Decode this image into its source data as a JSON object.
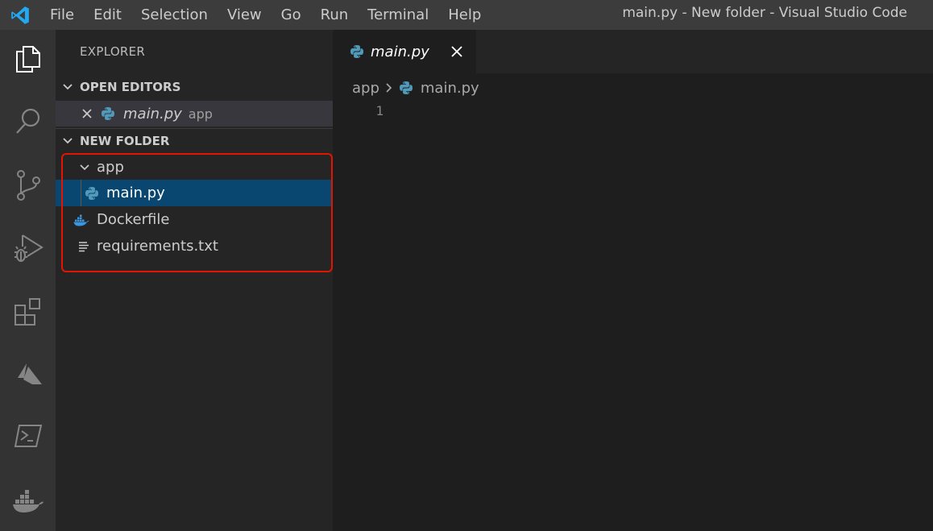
{
  "menu": [
    "File",
    "Edit",
    "Selection",
    "View",
    "Go",
    "Run",
    "Terminal",
    "Help"
  ],
  "window_title": "main.py - New folder - Visual Studio Code",
  "activity_bar": [
    "files-icon",
    "search-icon",
    "source-control-icon",
    "run-debug-icon",
    "extensions-icon",
    "azure-icon",
    "powershell-icon",
    "docker-icon"
  ],
  "sidebar": {
    "title": "EXPLORER",
    "open_editors": {
      "header": "OPEN EDITORS",
      "items": [
        {
          "name": "main.py",
          "folder": "app"
        }
      ]
    },
    "folder": {
      "header": "NEW FOLDER",
      "items": [
        {
          "name": "app",
          "type": "folder"
        },
        {
          "name": "main.py",
          "type": "python"
        },
        {
          "name": "Dockerfile",
          "type": "docker"
        },
        {
          "name": "requirements.txt",
          "type": "text"
        }
      ]
    }
  },
  "editor": {
    "tab_label": "main.py",
    "breadcrumb": [
      "app",
      "main.py"
    ],
    "line_numbers": [
      "1"
    ]
  },
  "colors": {
    "accent_selection": "#094771",
    "highlight_box": "#e51400",
    "python_icon": "#519aba",
    "docker_icon": "#3a96dd",
    "vscode_logo": "#23a9f2"
  }
}
